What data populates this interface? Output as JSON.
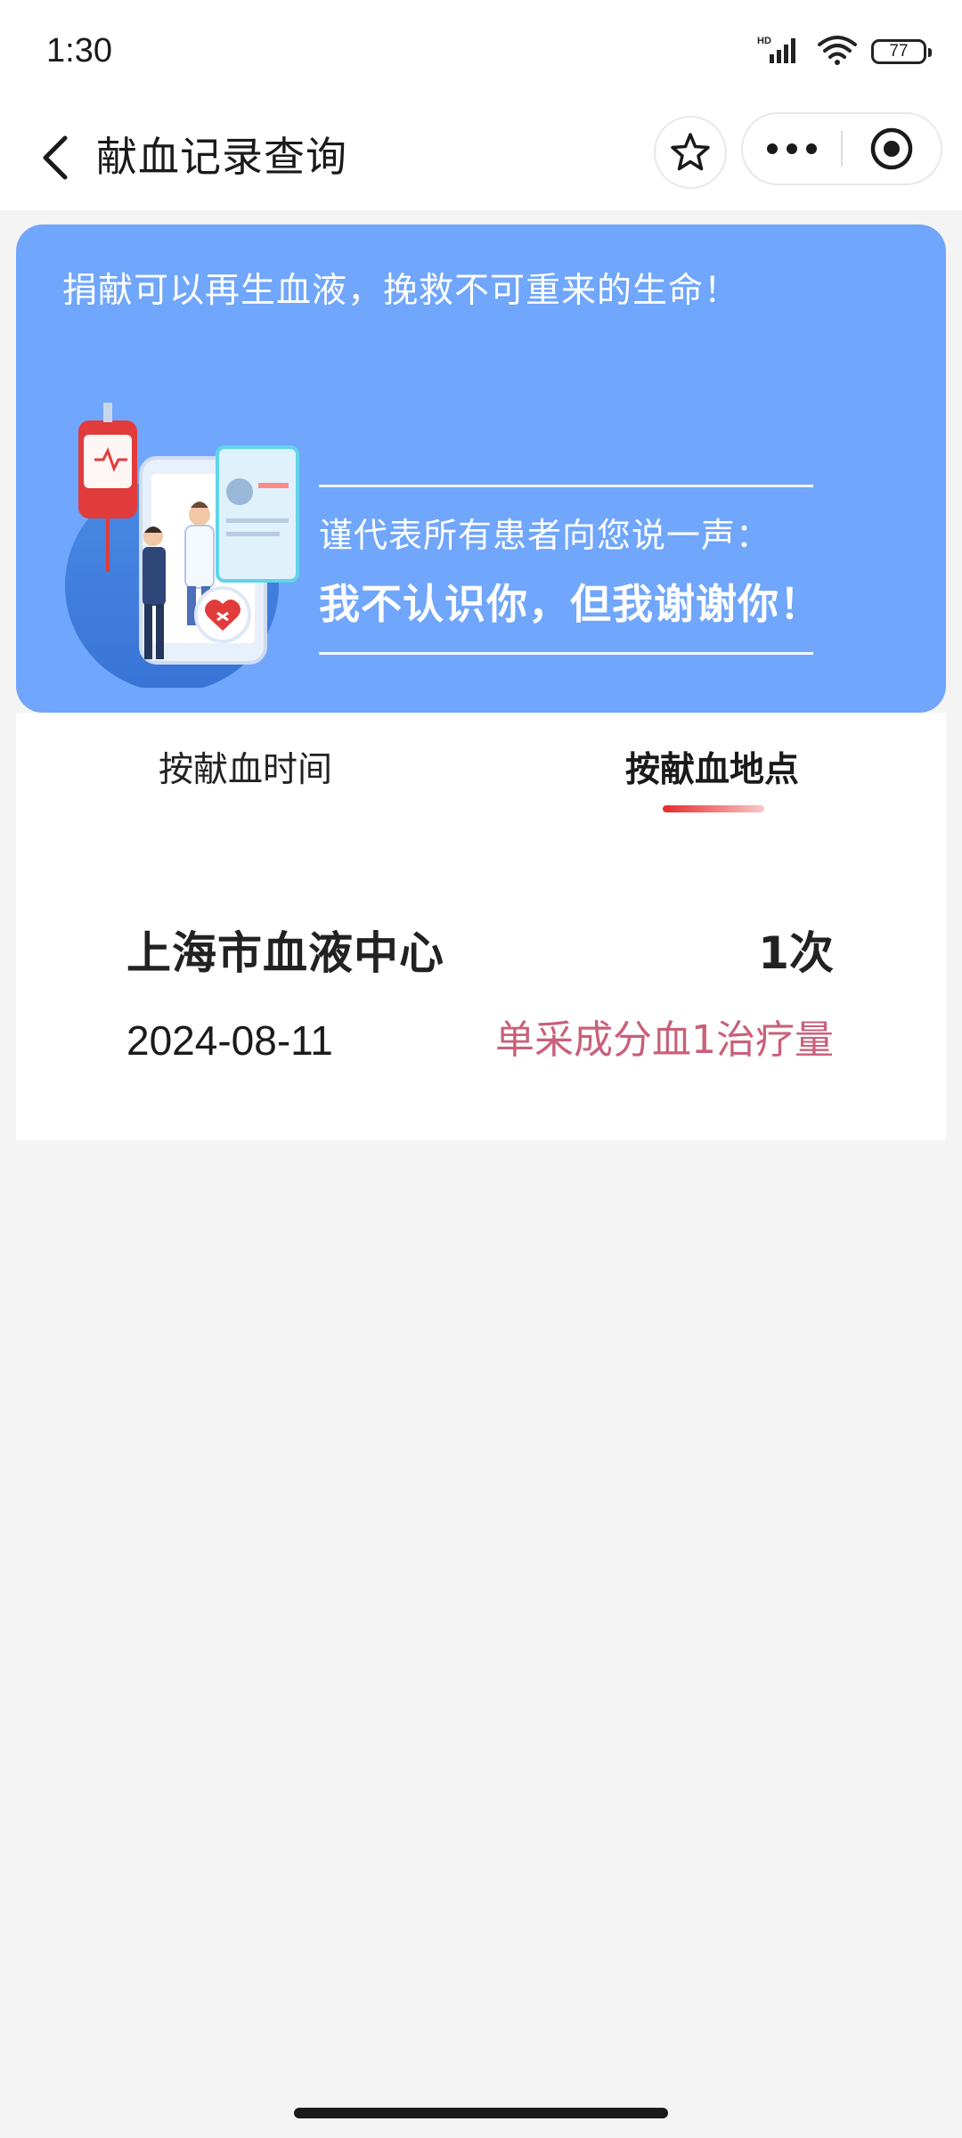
{
  "status_bar": {
    "time": "1:30",
    "network_badge": "HD",
    "battery_level": "77",
    "icons": [
      "signal-icon",
      "wifi-icon",
      "battery-icon"
    ]
  },
  "nav": {
    "title": "献血记录查询",
    "icons": [
      "back-arrow-icon",
      "star-icon",
      "more-dots-icon",
      "target-circle-icon"
    ]
  },
  "banner": {
    "slogan": "捐献可以再生血液，挽救不可重来的生命！",
    "thanks_line1": "谨代表所有患者向您说一声：",
    "thanks_line2": "我不认识你，但我谢谢你！",
    "background_color": "#70a6fb",
    "illustration": "doctor-blood-donation-illustration"
  },
  "tabs": {
    "items": [
      {
        "label": "按献血时间",
        "active": false
      },
      {
        "label": "按献血地点",
        "active": true
      }
    ],
    "indicator_color": "#e62b2b"
  },
  "records": [
    {
      "location": "上海市血液中心",
      "count": "1次",
      "date": "2024-08-11",
      "type": "单采成分血1治疗量",
      "type_color": "#c9607a"
    }
  ]
}
